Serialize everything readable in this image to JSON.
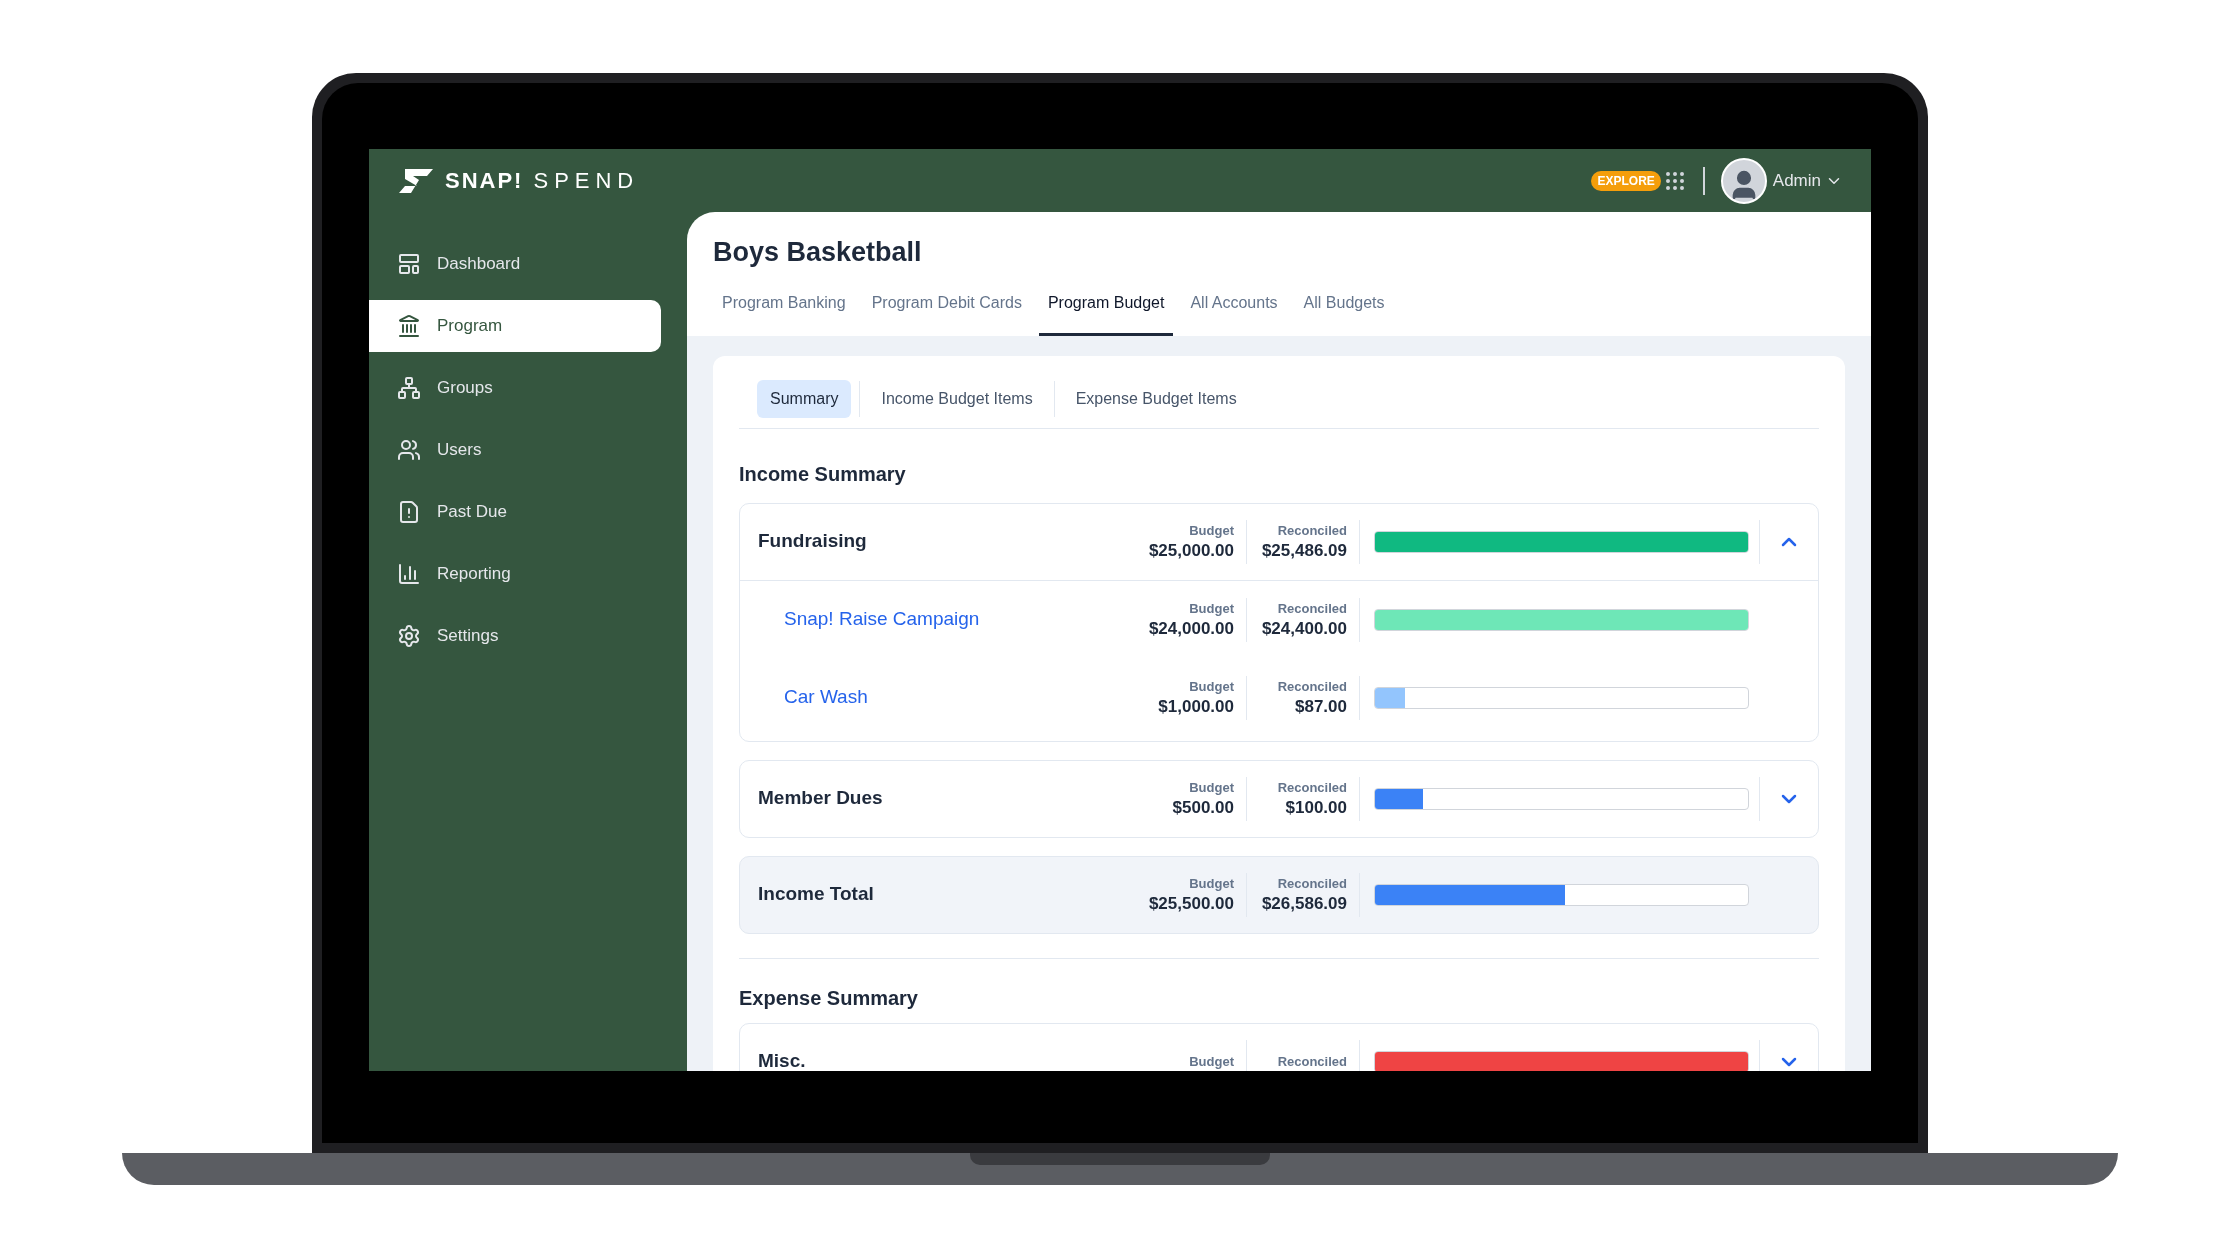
{
  "header": {
    "logo_bold": "SNAP!",
    "logo_light": "SPEND",
    "explore_badge": "EXPLORE",
    "user": "Admin"
  },
  "sidebar": {
    "items": [
      {
        "label": "Dashboard",
        "kind": "dashboard",
        "selected": false
      },
      {
        "label": "Program",
        "kind": "program",
        "selected": true
      },
      {
        "label": "Groups",
        "kind": "groups",
        "selected": false
      },
      {
        "label": "Users",
        "kind": "users",
        "selected": false
      },
      {
        "label": "Past Due",
        "kind": "pastdue",
        "selected": false
      },
      {
        "label": "Reporting",
        "kind": "reporting",
        "selected": false
      },
      {
        "label": "Settings",
        "kind": "settings",
        "selected": false
      }
    ]
  },
  "page": {
    "title": "Boys Basketball",
    "tabs": [
      {
        "label": "Program Banking",
        "selected": false
      },
      {
        "label": "Program Debit Cards",
        "selected": false
      },
      {
        "label": "Program Budget",
        "selected": true
      },
      {
        "label": "All Accounts",
        "selected": false
      },
      {
        "label": "All Budgets",
        "selected": false
      }
    ],
    "subtabs": [
      {
        "label": "Summary",
        "selected": true
      },
      {
        "label": "Income Budget Items",
        "selected": false
      },
      {
        "label": "Expense Budget Items",
        "selected": false
      }
    ]
  },
  "income_summary": {
    "title": "Income Summary",
    "groups": [
      {
        "name": "Fundraising",
        "budget_label": "Budget",
        "budget": "$25,000.00",
        "reconciled_label": "Reconciled",
        "reconciled": "$25,486.09",
        "level": 1,
        "color": "#10b981",
        "expanded": true,
        "children": [
          {
            "name": "Snap! Raise Campaign",
            "budget_label": "Budget",
            "budget": "$24,000.00",
            "reconciled_label": "Reconciled",
            "reconciled": "$24,400.00",
            "level": 1,
            "color": "#6ee7b7"
          },
          {
            "name": "Car Wash",
            "budget_label": "Budget",
            "budget": "$1,000.00",
            "reconciled_label": "Reconciled",
            "reconciled": "$87.00",
            "level": 0.08,
            "color": "#93c5fd"
          }
        ]
      },
      {
        "name": "Member Dues",
        "budget_label": "Budget",
        "budget": "$500.00",
        "reconciled_label": "Reconciled",
        "reconciled": "$100.00",
        "level": 0.13,
        "color": "#3b82f6",
        "expanded": false
      }
    ],
    "total": {
      "name": "Income Total",
      "budget_label": "Budget",
      "budget": "$25,500.00",
      "reconciled_label": "Reconciled",
      "reconciled": "$26,586.09",
      "level": 0.51,
      "color": "#3b82f6"
    }
  },
  "expense_summary": {
    "title": "Expense Summary",
    "groups": [
      {
        "name": "Misc.",
        "budget_label": "Budget",
        "reconciled_label": "Reconciled",
        "level": 1,
        "color": "#ef4444",
        "expanded": false
      }
    ]
  }
}
